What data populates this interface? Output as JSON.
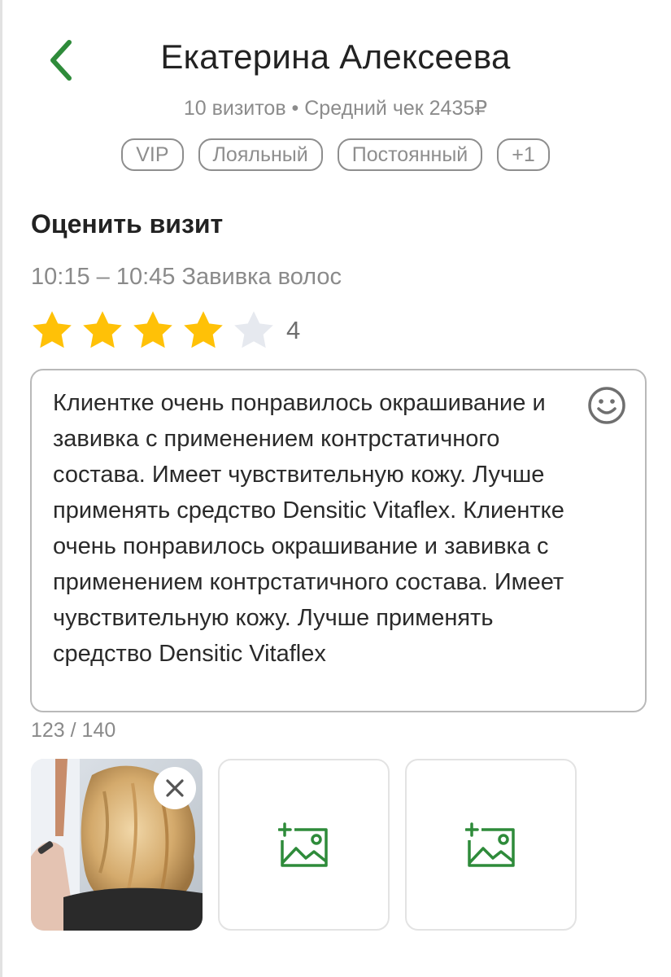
{
  "header": {
    "back_icon": "chevron-left-icon",
    "client_name": "Екатерина Алексеева",
    "client_meta": "10 визитов • Средний чек 2435₽"
  },
  "tags": [
    "VIP",
    "Лояльный",
    "Постоянный",
    "+1"
  ],
  "rate_visit": {
    "title": "Оценить визит",
    "visit_info": "10:15 – 10:45 Завивка волос",
    "rating": {
      "value": "4",
      "max": 5,
      "filled": 4
    }
  },
  "comment": {
    "text": "Клиентке очень понравилось окрашивание и завивка с применением контрстатичного состава. Имеет чувствительную кожу. Лучше применять средство Densitic Vitaflex. Клиентке очень понравилось окрашивание и завивка с применением контрстатичного состава. Имеет чувствительную кожу. Лучше применять средство Densitic Vitaflex",
    "counter": "123 / 140",
    "emoji_icon": "smiley-icon"
  },
  "photos": {
    "remove_icon": "close-icon",
    "add_icon": "add-image-icon"
  },
  "colors": {
    "accent_green": "#2e8b3a",
    "star_filled": "#ffc107",
    "star_empty": "#e6e9ef",
    "muted_text": "#8a8a8a"
  }
}
